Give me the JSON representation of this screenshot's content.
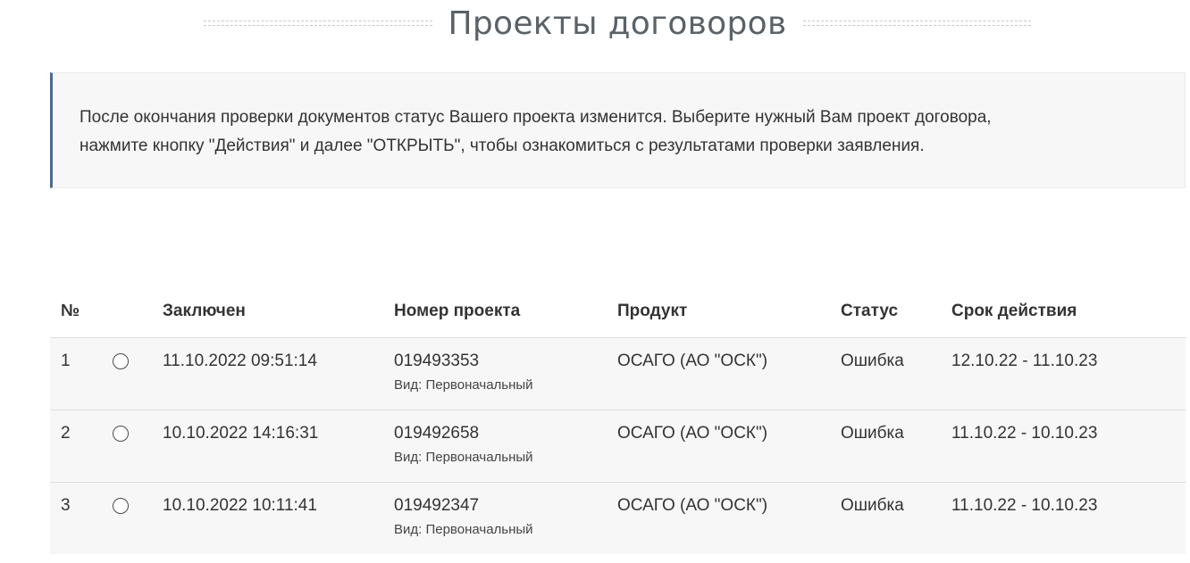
{
  "page": {
    "title": "Проекты договоров"
  },
  "info": {
    "line1": "После окончания проверки документов статус Вашего проекта изменится. Выберите нужный Вам проект договора,",
    "line2": "нажмите кнопку \"Действия\" и далее \"ОТКРЫТЬ\", чтобы ознакомиться с результатами проверки заявления."
  },
  "table": {
    "headers": {
      "num": "№",
      "select": "",
      "date": "Заключен",
      "project": "Номер проекта",
      "product": "Продукт",
      "status": "Статус",
      "term": "Срок действия"
    },
    "rows": [
      {
        "num": "1",
        "date": "11.10.2022 09:51:14",
        "project": "019493353",
        "type": "Вид: Первоначальный",
        "product": "ОСАГО (АО \"ОСК\")",
        "status": "Ошибка",
        "term": "12.10.22 - 11.10.23"
      },
      {
        "num": "2",
        "date": "10.10.2022 14:16:31",
        "project": "019492658",
        "type": "Вид: Первоначальный",
        "product": "ОСАГО (АО \"ОСК\")",
        "status": "Ошибка",
        "term": "11.10.22 - 10.10.23"
      },
      {
        "num": "3",
        "date": "10.10.2022 10:11:41",
        "project": "019492347",
        "type": "Вид: Первоначальный",
        "product": "ОСАГО (АО \"ОСК\")",
        "status": "Ошибка",
        "term": "11.10.22 - 10.10.23"
      }
    ]
  },
  "colors": {
    "accent_border": "#4a6a96",
    "title": "#5a6268",
    "row_bg": "#f7f7f7"
  }
}
